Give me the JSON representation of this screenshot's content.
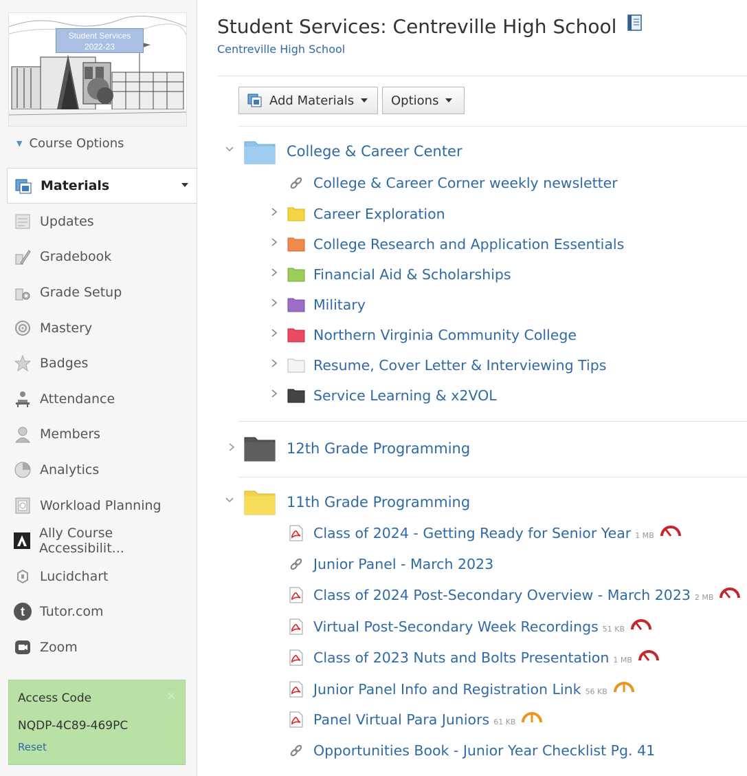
{
  "sidebar": {
    "course_image_text_line1": "Student Services",
    "course_image_text_line2": "2022-23",
    "course_options_label": "Course Options",
    "nav_items": [
      {
        "label": "Materials",
        "icon": "materials-icon",
        "active": true
      },
      {
        "label": "Updates",
        "icon": "updates-icon"
      },
      {
        "label": "Gradebook",
        "icon": "gradebook-icon"
      },
      {
        "label": "Grade Setup",
        "icon": "grade-setup-icon"
      },
      {
        "label": "Mastery",
        "icon": "mastery-icon"
      },
      {
        "label": "Badges",
        "icon": "badges-icon"
      },
      {
        "label": "Attendance",
        "icon": "attendance-icon"
      },
      {
        "label": "Members",
        "icon": "members-icon"
      },
      {
        "label": "Analytics",
        "icon": "analytics-icon"
      },
      {
        "label": "Workload Planning",
        "icon": "workload-planning-icon"
      },
      {
        "label": "Ally Course Accessibilit...",
        "icon": "ally-icon"
      },
      {
        "label": "Lucidchart",
        "icon": "lucidchart-icon"
      },
      {
        "label": "Tutor.com",
        "icon": "tutor-icon"
      },
      {
        "label": "Zoom",
        "icon": "zoom-icon"
      }
    ],
    "access_code": {
      "title": "Access Code",
      "code": "NQDP-4C89-469PC",
      "reset_label": "Reset",
      "close_glyph": "×"
    }
  },
  "header": {
    "title": "Student Services: Centreville High School",
    "subtitle": "Centreville High School"
  },
  "toolbar": {
    "add_materials_label": "Add Materials",
    "options_label": "Options"
  },
  "materials": {
    "college_career": {
      "title": "College & Career Center",
      "folder_color": "#8ec2ea",
      "items": [
        {
          "type": "link",
          "title": "College & Career Corner weekly newsletter"
        },
        {
          "type": "folder",
          "title": "Career Exploration",
          "color": "#f5d442"
        },
        {
          "type": "folder",
          "title": "College Research and Application Essentials",
          "color": "#f08a4b"
        },
        {
          "type": "folder",
          "title": "Financial Aid & Scholarships",
          "color": "#9ccc5a"
        },
        {
          "type": "folder",
          "title": "Military",
          "color": "#9b6dc6"
        },
        {
          "type": "folder",
          "title": "Northern Virginia Community College",
          "color": "#e84a64"
        },
        {
          "type": "folder",
          "title": "Resume, Cover Letter & Interviewing Tips",
          "color": "#f1f1f1"
        },
        {
          "type": "folder",
          "title": "Service Learning & x2VOL",
          "color": "#444444"
        }
      ]
    },
    "grade12": {
      "title": "12th Grade Programming",
      "folder_color": "#555555"
    },
    "grade11": {
      "title": "11th Grade Programming",
      "folder_color": "#f3d34a",
      "items": [
        {
          "type": "pdf",
          "title": "Class of 2024 - Getting Ready for Senior Year",
          "size": "1 MB",
          "gauge": "red"
        },
        {
          "type": "link",
          "title": "Junior Panel - March 2023"
        },
        {
          "type": "pdf",
          "title": "Class of 2024 Post-Secondary Overview - March 2023",
          "size": "2 MB",
          "gauge": "red"
        },
        {
          "type": "pdf",
          "title": "Virtual Post-Secondary Week Recordings",
          "size": "51 KB",
          "gauge": "red"
        },
        {
          "type": "pdf",
          "title": "Class of 2023 Nuts and Bolts Presentation",
          "size": "1 MB",
          "gauge": "red"
        },
        {
          "type": "pdf",
          "title": "Junior Panel Info and Registration Link",
          "size": "56 KB",
          "gauge": "orange"
        },
        {
          "type": "pdf",
          "title": "Panel Virtual Para Juniors",
          "size": "61 KB",
          "gauge": "orange"
        },
        {
          "type": "link",
          "title": "Opportunities Book - Junior Year Checklist Pg. 41"
        }
      ]
    }
  },
  "colors": {
    "link_blue": "#2f6aa6",
    "gauge_red": "#c0282d",
    "gauge_orange": "#e8961e",
    "access_green": "#b9e0a5"
  }
}
